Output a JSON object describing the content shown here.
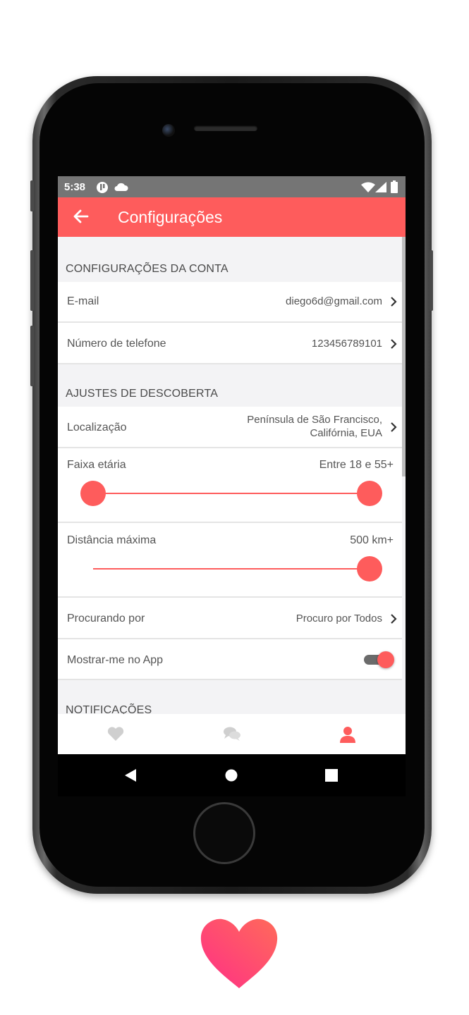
{
  "status_bar": {
    "time": "5:38",
    "left_icons": [
      "notification-icon",
      "cloud-icon"
    ],
    "right_icons": [
      "wifi-icon",
      "signal-icon",
      "battery-icon"
    ]
  },
  "app_bar": {
    "title": "Configurações",
    "back_icon": "arrow-left-icon",
    "color": "#fe5c5c"
  },
  "account_section": {
    "header": "CONFIGURAÇÕES DA CONTA",
    "email": {
      "label": "E-mail",
      "value": "diego6d@gmail.com"
    },
    "phone": {
      "label": "Número de telefone",
      "value": "123456789101"
    }
  },
  "discovery_section": {
    "header": "AJUSTES DE DESCOBERTA",
    "location": {
      "label": "Localização",
      "value_line1": "Península de São Francisco,",
      "value_line2": "Califórnia, EUA"
    },
    "age_range": {
      "label": "Faixa etária",
      "value": "Entre 18 e 55+",
      "min": 18,
      "max": 55,
      "low_fraction": 0.0,
      "high_fraction": 1.0
    },
    "max_distance": {
      "label": "Distância máxima",
      "value": "500 km+",
      "fraction": 1.0
    },
    "looking_for": {
      "label": "Procurando por",
      "value": "Procuro por Todos"
    },
    "show_me": {
      "label": "Mostrar-me no App",
      "enabled": true
    }
  },
  "notifications_section": {
    "header": "NOTIFICAÇÕES"
  },
  "tab_bar": {
    "tabs": [
      {
        "name": "heart-icon",
        "active": false
      },
      {
        "name": "chat-icon",
        "active": false
      },
      {
        "name": "profile-icon",
        "active": true
      }
    ],
    "active_color": "#fe5c5c",
    "inactive_color": "#cfcfcf"
  },
  "nav_bar": {
    "buttons": [
      "back-triangle-icon",
      "home-circle-icon",
      "recents-square-icon"
    ]
  }
}
